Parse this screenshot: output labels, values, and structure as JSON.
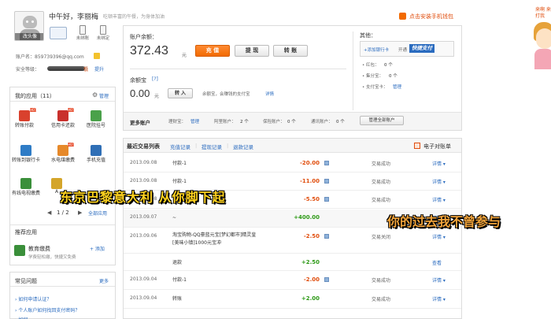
{
  "header": {
    "greeting": "中午好，李丽梅",
    "greeting_sub": "吃顿丰富的午餐，为身体加油",
    "avatar_caption": "改头像",
    "quick": [
      {
        "label": "",
        "icon": "id-card-icon"
      },
      {
        "label": "未绑账",
        "icon": "mobile-icon"
      },
      {
        "label": "未绑定",
        "icon": "phone-icon"
      }
    ],
    "account_label": "账户名：859739396@qq.com",
    "security_label": "安全等级：",
    "security_level": "低",
    "security_fill": 0.92,
    "upgrade": "提升",
    "install_phone_wallet": "点击安装手机钱包"
  },
  "balance": {
    "title": "账户余额：",
    "amount": "372.43",
    "unit": "元",
    "buttons": [
      "充 值",
      "提 现",
      "转 账"
    ]
  },
  "yuebao": {
    "title": "余额宝",
    "help": "[?]",
    "amount": "0.00",
    "unit": "元",
    "transfer_in": "转 入",
    "desc": "余额宝，会赚钱的支付宝",
    "detail": "详情"
  },
  "other": {
    "title": "其他：",
    "add_bank": "+添加银行卡",
    "open": "开通",
    "quickpay": "快捷支付",
    "items": [
      {
        "label": "• 红包：",
        "value": "0 个"
      },
      {
        "label": "• 集分宝：",
        "value": "0 个"
      },
      {
        "label": "• 支付宝卡：",
        "value": "管理"
      }
    ]
  },
  "more_accounts": {
    "title": "更多账户",
    "items": [
      {
        "label": "理财宝：",
        "value": "管理"
      },
      {
        "label": "阿里账户：",
        "value": "2 个"
      },
      {
        "label": "保险账户：",
        "value": "0 个"
      },
      {
        "label": "通讯账户：",
        "value": "0 个"
      }
    ],
    "manage_all": "管理全部账户"
  },
  "apps": {
    "title": "我的应用（11）",
    "manage": "管理",
    "items": [
      {
        "label": "转账付款",
        "icon": "transfer-icon",
        "color": "#d9412d",
        "hot": true
      },
      {
        "label": "信用卡还款",
        "icon": "credit-card-icon",
        "color": "#c9302c",
        "hot": true
      },
      {
        "label": "医院挂号",
        "icon": "hospital-icon",
        "color": "#4aa14a",
        "hot": false
      },
      {
        "label": "转账到银行卡",
        "icon": "bank-transfer-icon",
        "color": "#2f7cc6",
        "hot": false
      },
      {
        "label": "水电煤缴费",
        "icon": "utilities-icon",
        "color": "#e6892a",
        "hot": true
      },
      {
        "label": "手机充值",
        "icon": "mobile-topup-icon",
        "color": "#2f6fb6",
        "hot": false
      },
      {
        "label": "有线电视缴费",
        "icon": "tv-icon",
        "color": "#3a8f3a",
        "hot": false
      },
      {
        "label": "A",
        "icon": "app-icon",
        "color": "#d4a52a",
        "hot": false
      }
    ],
    "pager": "1 / 2",
    "all_apps": "全部应用"
  },
  "recommend": {
    "title": "推荐应用",
    "item_title": "教育缴费",
    "item_add": "+ 添加",
    "item_desc": "学费轻松缴，快捷又免费"
  },
  "faq": {
    "title": "常见问题",
    "more": "更多",
    "items": [
      "如何申请认证？",
      "个人账户如何找回支付密码？",
      "如何"
    ]
  },
  "transactions": {
    "title": "最近交易列表",
    "tabs": [
      "充值记录",
      "提现记录",
      "退款记录"
    ],
    "statement": "电子对账单",
    "rows": [
      {
        "date": "2013.09.08",
        "desc": "付款-1",
        "amount": "-20.00",
        "status": "交易成功",
        "action": "详情 ▾"
      },
      {
        "date": "2013.09.08",
        "desc": "付款-1",
        "amount": "-11.00",
        "status": "交易成功",
        "action": "详情 ▾"
      },
      {
        "date": "2013.09.08",
        "desc": "",
        "amount": "-5.50",
        "status": "交易成功",
        "action": "详情 ▾"
      },
      {
        "date": "2013.09.07",
        "desc": "~",
        "amount": "+400.00",
        "status": "",
        "action": "详情 ▾"
      },
      {
        "date": "2013.09.06",
        "desc": "淘宝购物-QQ豪蓝元宝[梦幻都市]精灵皇[美味小镇]1000元宝冲",
        "amount": "-2.50",
        "status": "交易关闭",
        "action": "详情 ▾"
      },
      {
        "date": "",
        "desc": "退款",
        "amount": "+2.50",
        "status": "",
        "action": "查看"
      },
      {
        "date": "2013.09.04",
        "desc": "付款-1",
        "amount": "-2.00",
        "status": "交易成功",
        "action": "详情 ▾"
      },
      {
        "date": "2013.09.04",
        "desc": "转账",
        "amount": "+2.00",
        "status": "交易成功",
        "action": "详情 ▾"
      }
    ],
    "footer_right": "查看所有交易记录"
  },
  "overlays": {
    "caption1": "东京巴黎意大利 从你脚下起",
    "caption2": "你的过去我不曾参与",
    "corner": "来啊 来打我"
  },
  "colors": {
    "accent": "#f26a00",
    "link": "#2a6bbf",
    "negative": "#e04e0e",
    "positive": "#2e9a17"
  }
}
